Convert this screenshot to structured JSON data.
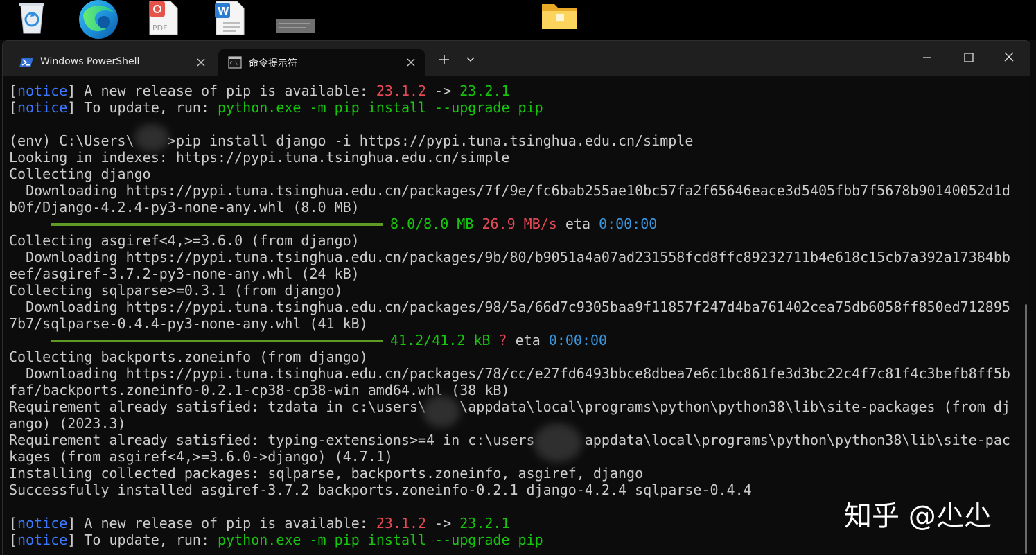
{
  "desktop": {
    "icons": [
      {
        "name": "recycle-bin-icon"
      },
      {
        "name": "edge-icon"
      },
      {
        "name": "pdf-file-icon",
        "label": "PDF"
      },
      {
        "name": "word-file-icon"
      },
      {
        "name": "image-thumbnail-icon"
      },
      {
        "name": "folder-icon"
      }
    ]
  },
  "window": {
    "tabs": [
      {
        "label": "Windows PowerShell",
        "icon": "powershell-icon",
        "active": false
      },
      {
        "label": "命令提示符",
        "icon": "cmd-icon",
        "active": true
      }
    ]
  },
  "terminal": {
    "lines": [
      [
        {
          "t": "["
        },
        {
          "t": "notice",
          "c": "blue"
        },
        {
          "t": "] A new release of pip is available: "
        },
        {
          "t": "23.1.2",
          "c": "red"
        },
        {
          "t": " -> "
        },
        {
          "t": "23.2.1",
          "c": "green"
        }
      ],
      [
        {
          "t": "["
        },
        {
          "t": "notice",
          "c": "blue"
        },
        {
          "t": "] To update, run: "
        },
        {
          "t": "python.exe -m pip install --upgrade pip",
          "c": "green"
        }
      ],
      [],
      [
        {
          "t": "(env) C:\\Users\\    >pip install django -i https://pypi.tuna.tsinghua.edu.cn/simple"
        }
      ],
      [
        {
          "t": "Looking in indexes: https://pypi.tuna.tsinghua.edu.cn/simple"
        }
      ],
      [
        {
          "t": "Collecting django"
        }
      ],
      [
        {
          "t": "  Downloading https://pypi.tuna.tsinghua.edu.cn/packages/7f/9e/fc6bab255ae10bc57fa2f65646eace3d5405fbb7f5678b90140052d1d"
        }
      ],
      [
        {
          "t": "b0f/Django-4.2.4-py3-none-any.whl (8.0 MB)"
        }
      ],
      [
        {
          "bar": true
        },
        {
          "t": "8.0/8.0 MB",
          "c": "green"
        },
        {
          "t": " "
        },
        {
          "t": "26.9 MB/s",
          "c": "red"
        },
        {
          "t": " eta "
        },
        {
          "t": "0:00:00",
          "c": "ltblue"
        }
      ],
      [
        {
          "t": "Collecting asgiref<4,>=3.6.0 (from django)"
        }
      ],
      [
        {
          "t": "  Downloading https://pypi.tuna.tsinghua.edu.cn/packages/9b/80/b9051a4a07ad231558fcd8ffc89232711b4e618c15cb7a392a17384bb"
        }
      ],
      [
        {
          "t": "eef/asgiref-3.7.2-py3-none-any.whl (24 kB)"
        }
      ],
      [
        {
          "t": "Collecting sqlparse>=0.3.1 (from django)"
        }
      ],
      [
        {
          "t": "  Downloading https://pypi.tuna.tsinghua.edu.cn/packages/98/5a/66d7c9305baa9f11857f247d4ba761402cea75db6058ff850ed712895"
        }
      ],
      [
        {
          "t": "7b7/sqlparse-0.4.4-py3-none-any.whl (41 kB)"
        }
      ],
      [
        {
          "bar": true
        },
        {
          "t": "41.2/41.2 kB",
          "c": "green"
        },
        {
          "t": " "
        },
        {
          "t": "?",
          "c": "red"
        },
        {
          "t": " eta "
        },
        {
          "t": "0:00:00",
          "c": "ltblue"
        }
      ],
      [
        {
          "t": "Collecting backports.zoneinfo (from django)"
        }
      ],
      [
        {
          "t": "  Downloading https://pypi.tuna.tsinghua.edu.cn/packages/78/cc/e27fd6493bbce8dbea7e6c1bc861fe3d3bc22c4f7c81f4c3befb8ff5b"
        }
      ],
      [
        {
          "t": "faf/backports.zoneinfo-0.2.1-cp38-cp38-win_amd64.whl (38 kB)"
        }
      ],
      [
        {
          "t": "Requirement already satisfied: tzdata in c:\\users\\    \\appdata\\local\\programs\\python\\python38\\lib\\site-packages (from dj"
        }
      ],
      [
        {
          "t": "ango) (2023.3)"
        }
      ],
      [
        {
          "t": "Requirement already satisfied: typing-extensions>=4 in c:\\users      appdata\\local\\programs\\python\\python38\\lib\\site-pac"
        }
      ],
      [
        {
          "t": "kages (from asgiref<4,>=3.6.0->django) (4.7.1)"
        }
      ],
      [
        {
          "t": "Installing collected packages: sqlparse, backports.zoneinfo, asgiref, django"
        }
      ],
      [
        {
          "t": "Successfully installed asgiref-3.7.2 backports.zoneinfo-0.2.1 django-4.2.4 sqlparse-0.4.4"
        }
      ],
      [],
      [
        {
          "t": "["
        },
        {
          "t": "notice",
          "c": "blue"
        },
        {
          "t": "] A new release of pip is available: "
        },
        {
          "t": "23.1.2",
          "c": "red"
        },
        {
          "t": " -> "
        },
        {
          "t": "23.2.1",
          "c": "green"
        }
      ],
      [
        {
          "t": "["
        },
        {
          "t": "notice",
          "c": "blue"
        },
        {
          "t": "] To update, run: "
        },
        {
          "t": "python.exe -m pip install --upgrade pip",
          "c": "green"
        }
      ]
    ]
  },
  "watermark": {
    "text": "知乎 @尐尐"
  },
  "colors": {
    "blue": "#3b78ff",
    "red": "#e74856",
    "green": "#16c60c",
    "ltblue": "#3a96dd",
    "progress": "#5f9b24",
    "titlebar": "#1f1f1f",
    "background": "#0c0c0c"
  }
}
